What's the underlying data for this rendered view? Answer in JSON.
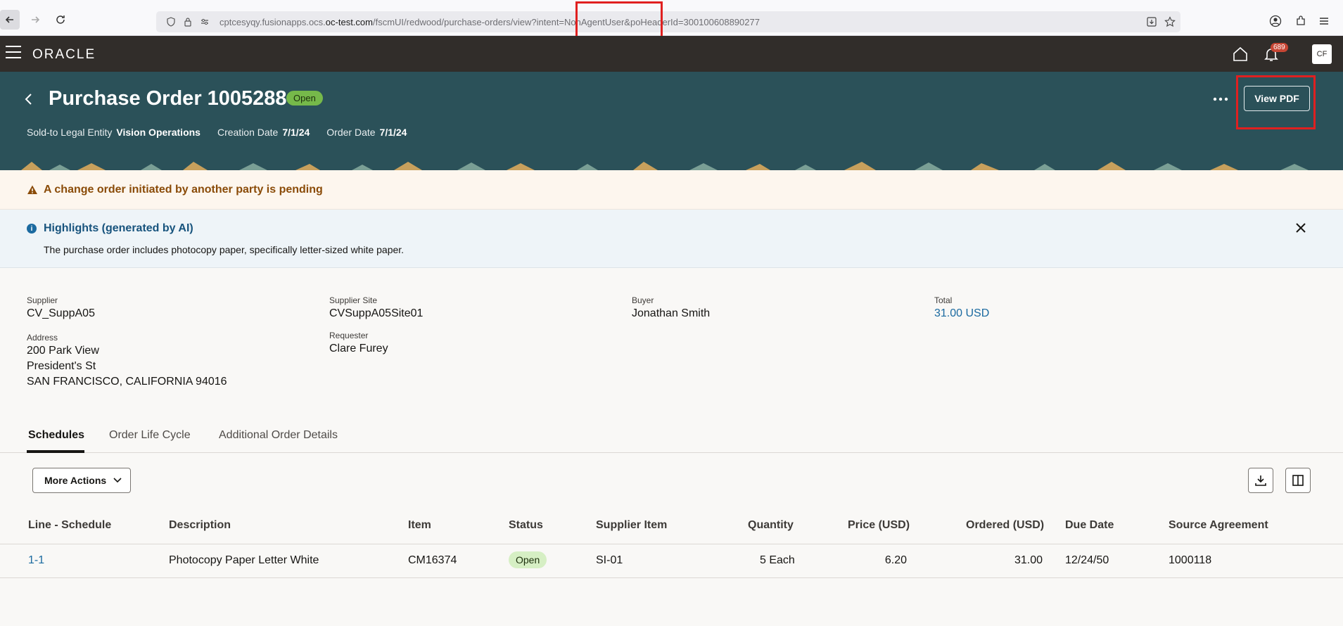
{
  "browser": {
    "url_prefix": "cptcesyqy.fusionapps.ocs.",
    "url_host": "oc-test.com",
    "url_path": "/fscmUI/redwood/purchase-orders/view?intent=NonAgentUser&poHeaderId=300100608890277"
  },
  "appbar": {
    "logo": "ORACLE",
    "notification_count": "689",
    "user_initials": "CF"
  },
  "header": {
    "title": "Purchase Order 1005288",
    "status": "Open",
    "meta": [
      {
        "label": "Sold-to Legal Entity",
        "value": "Vision Operations"
      },
      {
        "label": "Creation Date",
        "value": "7/1/24"
      },
      {
        "label": "Order Date",
        "value": "7/1/24"
      }
    ],
    "view_pdf_label": "View PDF"
  },
  "warning": {
    "text": "A change order initiated by another party is pending"
  },
  "highlights": {
    "title": "Highlights (generated by AI)",
    "description": "The purchase order includes photocopy paper, specifically letter-sized white paper."
  },
  "details": {
    "supplier": {
      "label": "Supplier",
      "value": "CV_SuppA05"
    },
    "supplier_site": {
      "label": "Supplier Site",
      "value": "CVSuppA05Site01"
    },
    "buyer": {
      "label": "Buyer",
      "value": "Jonathan Smith"
    },
    "total": {
      "label": "Total",
      "value": "31.00 USD"
    },
    "address": {
      "label": "Address",
      "line1": "200 Park View",
      "line2": "President's St",
      "line3": "SAN FRANCISCO, CALIFORNIA 94016"
    },
    "requester": {
      "label": "Requester",
      "value": "Clare Furey"
    }
  },
  "tabs": [
    "Schedules",
    "Order Life Cycle",
    "Additional Order Details"
  ],
  "toolbar": {
    "more_actions_label": "More Actions"
  },
  "table": {
    "headers": [
      "Line - Schedule",
      "Description",
      "Item",
      "Status",
      "Supplier Item",
      "Quantity",
      "Price (USD)",
      "Ordered (USD)",
      "Due Date",
      "Source Agreement"
    ],
    "rows": [
      {
        "line_schedule": "1-1",
        "description": "Photocopy Paper Letter White",
        "item": "CM16374",
        "status": "Open",
        "supplier_item": "SI-01",
        "quantity": "5 Each",
        "price": "6.20",
        "ordered": "31.00",
        "due_date": "12/24/50",
        "source_agreement": "1000118"
      }
    ]
  },
  "colors": {
    "header_bg": "#2b5159",
    "appbar_bg": "#312d2a",
    "link": "#1b6aa0",
    "warning_text": "#8a4b08",
    "annotation_red": "#e02020"
  }
}
